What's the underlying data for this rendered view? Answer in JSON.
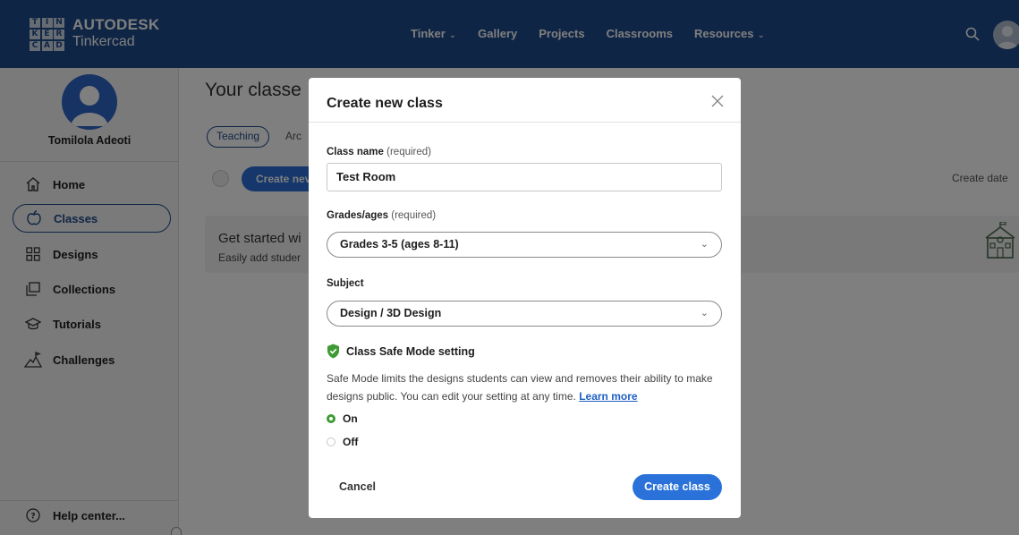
{
  "topbar": {
    "logo_letters": [
      "T",
      "I",
      "N",
      "K",
      "E",
      "R",
      "C",
      "A",
      "D"
    ],
    "brand_line1": "AUTODESK",
    "brand_line2": "Tinkercad",
    "nav": [
      {
        "label": "Tinker",
        "has_dropdown": true
      },
      {
        "label": "Gallery",
        "has_dropdown": false
      },
      {
        "label": "Projects",
        "has_dropdown": false
      },
      {
        "label": "Classrooms",
        "has_dropdown": false
      },
      {
        "label": "Resources",
        "has_dropdown": true
      }
    ],
    "icons": {
      "search": "search-icon",
      "avatar": "user-avatar-icon"
    }
  },
  "sidebar": {
    "username": "Tomilola Adeoti",
    "items": [
      {
        "label": "Home",
        "icon": "home-icon",
        "active": false
      },
      {
        "label": "Classes",
        "icon": "apple-icon",
        "active": true
      },
      {
        "label": "Designs",
        "icon": "grid-icon",
        "active": false
      },
      {
        "label": "Collections",
        "icon": "collections-icon",
        "active": false
      },
      {
        "label": "Tutorials",
        "icon": "graduation-cap-icon",
        "active": false
      },
      {
        "label": "Challenges",
        "icon": "mountain-flag-icon",
        "active": false
      }
    ],
    "help_label": "Help center..."
  },
  "main": {
    "title": "Your classe",
    "tabs": [
      "Teaching",
      "Arc"
    ],
    "create_button": "Create nev",
    "sort_label": "Create date",
    "banner_title": "Get started wi",
    "banner_sub": "Easily add studer"
  },
  "modal": {
    "title": "Create new class",
    "class_name_label": "Class name",
    "required_text": "(required)",
    "class_name_value": "Test Room",
    "grades_label": "Grades/ages",
    "grades_value": "Grades 3-5 (ages 8-11)",
    "subject_label": "Subject",
    "subject_value": "Design / 3D Design",
    "safe_mode_title": "Class Safe Mode setting",
    "safe_mode_desc": "Safe Mode limits the designs students can view and removes their ability to make designs public. You can edit your setting at any time.",
    "learn_more": "Learn more",
    "options": [
      {
        "label": "On",
        "selected": true
      },
      {
        "label": "Off",
        "selected": false
      }
    ],
    "cancel": "Cancel",
    "submit": "Create class"
  },
  "colors": {
    "topbar": "#1e4a8a",
    "primary_button": "#2a72d9",
    "safe_green": "#3e9b34",
    "link": "#1e5fc4"
  }
}
